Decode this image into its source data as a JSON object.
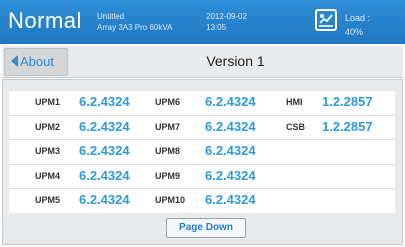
{
  "header": {
    "mode": "Normal",
    "name_line1": "Untitled",
    "name_line2": "Array 3A3 Pro 60kVA",
    "date": "2012-09-02",
    "time": "13:05",
    "load_label": "Load :",
    "load_value": "40%",
    "load_icon": "load-gauge-icon"
  },
  "nav": {
    "back_label": "About",
    "title": "Version 1"
  },
  "versions": [
    [
      {
        "label": "UPM1",
        "value": "6.2.4324"
      },
      {
        "label": "UPM6",
        "value": "6.2.4324"
      },
      {
        "label": "HMI",
        "value": "1.2.2857"
      }
    ],
    [
      {
        "label": "UPM2",
        "value": "6.2.4324"
      },
      {
        "label": "UPM7",
        "value": "6.2.4324"
      },
      {
        "label": "CSB",
        "value": "1.2.2857"
      }
    ],
    [
      {
        "label": "UPM3",
        "value": "6.2.4324"
      },
      {
        "label": "UPM8",
        "value": "6.2.4324"
      }
    ],
    [
      {
        "label": "UPM4",
        "value": "6.2.4324"
      },
      {
        "label": "UPM9",
        "value": "6.2.4324"
      }
    ],
    [
      {
        "label": "UPM5",
        "value": "6.2.4324"
      },
      {
        "label": "UPM10",
        "value": "6.2.4324"
      }
    ]
  ],
  "footer": {
    "page_down_label": "Page Down"
  },
  "colors": {
    "header_blue": "#1f77c0",
    "value_blue": "#2e9ad8"
  }
}
